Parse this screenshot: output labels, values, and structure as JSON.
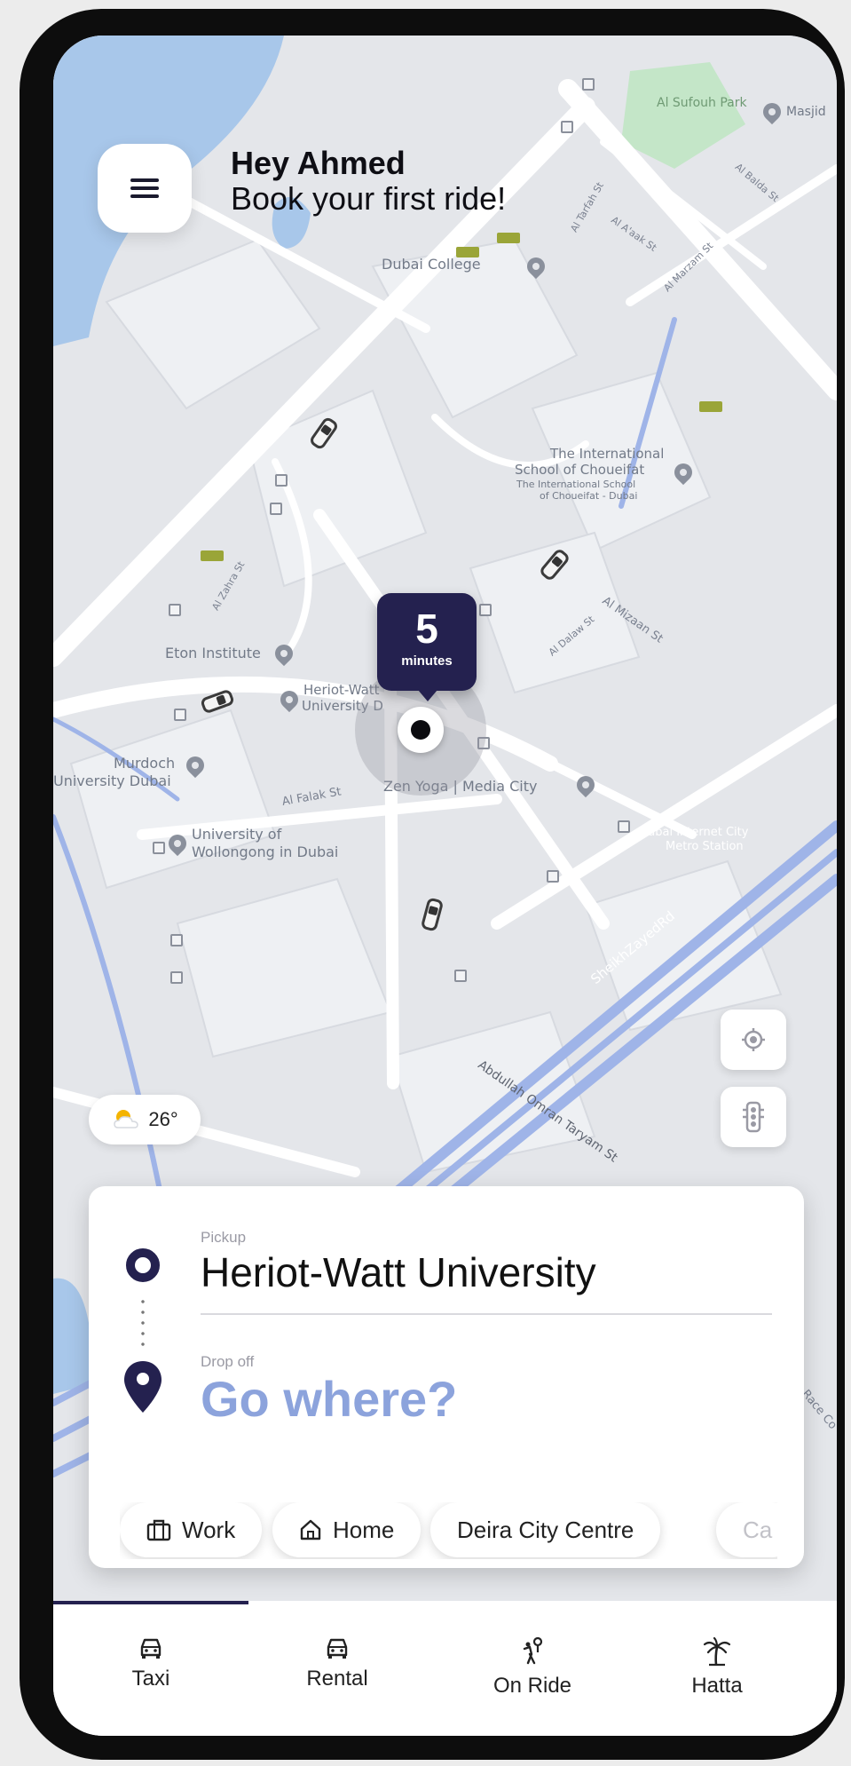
{
  "greeting": {
    "name": "Hey Ahmed",
    "subtitle": "Book your first ride!"
  },
  "map": {
    "labels": {
      "dubai_college": "Dubai College",
      "al_sufouh_park": "Al Sufouh Park",
      "masjid": "Masjid",
      "choueifat_1": "The International",
      "choueifat_2": "School of Choueifat",
      "choueifat_3": "The International School",
      "choueifat_4": "of Choueifat - Dubai",
      "eton": "Eton Institute",
      "heriot_watt_1": "Heriot-Watt",
      "heriot_watt_2": "University D",
      "murdoch_1": "Murdoch",
      "murdoch_2": "University Dubai",
      "zen_yoga": "Zen Yoga | Media City",
      "wollongong_1": "University of",
      "wollongong_2": "Wollongong in Dubai",
      "dubai_internet_city": "Dubai Internet City",
      "metro_station": "Metro Station"
    },
    "streets": {
      "al_falak": "Al Falak St",
      "al_mizaan": "Al Mizaan St",
      "al_dalaw": "Al Dalaw St",
      "al_zahra": "Al Zahra St",
      "al_tarfah": "Al Tarfah St",
      "al_aaak": "Al A'aak St",
      "al_mazam": "Al Marzam St",
      "al_balda": "Al Balda St",
      "sheikh_zayed": "SheikhZayedRd",
      "abdullah_omran": "Abdullah Omran Taryam St",
      "race_course": "Race Co"
    }
  },
  "eta": {
    "value": "5",
    "unit": "minutes"
  },
  "weather": {
    "temperature": "26°"
  },
  "ride": {
    "pickup_label": "Pickup",
    "pickup_value": "Heriot-Watt University",
    "dropoff_label": "Drop off",
    "dropoff_placeholder": "Go where?",
    "shortcuts": [
      {
        "label": "Work",
        "icon": "briefcase-icon"
      },
      {
        "label": "Home",
        "icon": "home-icon"
      },
      {
        "label": "Deira City Centre",
        "icon": ""
      },
      {
        "label": "Ca",
        "icon": ""
      }
    ]
  },
  "nav": {
    "items": [
      {
        "label": "Taxi",
        "icon": "car-icon"
      },
      {
        "label": "Rental",
        "icon": "car-icon"
      },
      {
        "label": "On Ride",
        "icon": "ride-icon"
      },
      {
        "label": "Hatta",
        "icon": "palm-tree-icon"
      }
    ]
  },
  "colors": {
    "primary": "#24214f",
    "accent_text": "#8ca3dc",
    "water": "#a8c7ea",
    "park": "#c4e6c8",
    "highway": "#9fb4e8"
  }
}
